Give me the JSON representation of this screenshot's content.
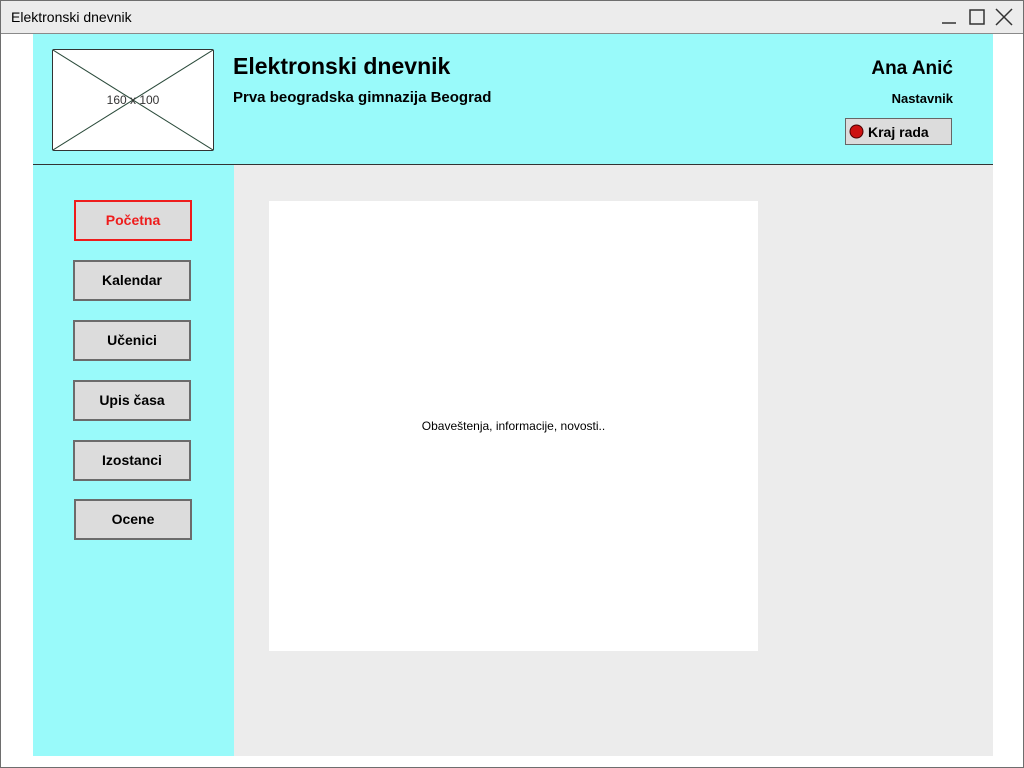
{
  "window": {
    "title": "Elektronski dnevnik"
  },
  "header": {
    "logo_placeholder": "160 x 100",
    "app_title": "Elektronski dnevnik",
    "school_name": "Prva beogradska gimnazija Beograd",
    "user_name": "Ana Anić",
    "user_role": "Nastavnik",
    "logout_label": "Kraj rada",
    "logout_icon": "stop-icon"
  },
  "sidebar": {
    "items": [
      {
        "label": "Početna",
        "active": true
      },
      {
        "label": "Kalendar",
        "active": false
      },
      {
        "label": "Učenici",
        "active": false
      },
      {
        "label": "Upis časa",
        "active": false
      },
      {
        "label": "Izostanci",
        "active": false
      },
      {
        "label": "Ocene",
        "active": false
      }
    ]
  },
  "main": {
    "news_text": "Obaveštenja, informacije, novosti.."
  },
  "colors": {
    "panel_bg": "#99fafa",
    "content_bg": "#ececec",
    "active_accent": "#ee1c1c",
    "button_bg": "#dcdcdc"
  }
}
